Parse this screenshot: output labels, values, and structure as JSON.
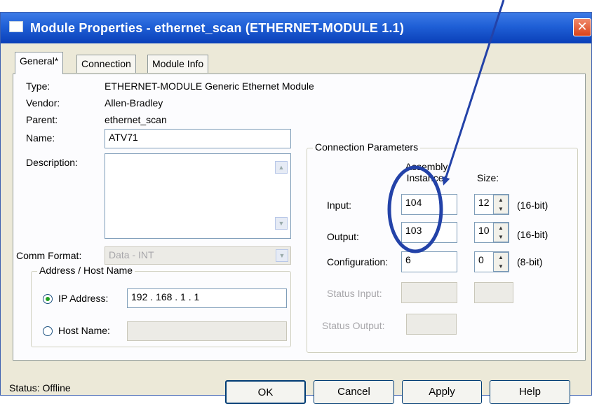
{
  "window": {
    "title": "Module Properties  - ethernet_scan (ETHERNET-MODULE 1.1)",
    "close_glyph": "✕"
  },
  "tabs": [
    {
      "label": "General*",
      "active": true
    },
    {
      "label": "Connection",
      "active": false
    },
    {
      "label": "Module Info",
      "active": false
    }
  ],
  "general": {
    "type_label": "Type:",
    "type_value": "ETHERNET-MODULE Generic Ethernet Module",
    "vendor_label": "Vendor:",
    "vendor_value": "Allen-Bradley",
    "parent_label": "Parent:",
    "parent_value": "ethernet_scan",
    "name_label": "Name:",
    "name_value": "ATV71",
    "description_label": "Description:",
    "description_value": "",
    "comm_format_label": "Comm Format:",
    "comm_format_value": "Data - INT"
  },
  "address_group": {
    "title": "Address / Host Name",
    "ip_label": "IP Address:",
    "ip_value": "192 . 168 .  1  .  1",
    "ip_selected": true,
    "host_label": "Host Name:",
    "host_value": ""
  },
  "connection_params": {
    "title": "Connection Parameters",
    "assembly_header": "Assembly Instance:",
    "size_header": "Size:",
    "rows": [
      {
        "label": "Input:",
        "instance": "104",
        "size": "12",
        "unit": "(16-bit)"
      },
      {
        "label": "Output:",
        "instance": "103",
        "size": "10",
        "unit": "(16-bit)"
      },
      {
        "label": "Configuration:",
        "instance": "6",
        "size": "0",
        "unit": "(8-bit)"
      }
    ],
    "status_input_label": "Status Input:",
    "status_output_label": "Status Output:"
  },
  "footer": {
    "status": "Status:  Offline",
    "ok": "OK",
    "cancel": "Cancel",
    "apply": "Apply",
    "help": "Help"
  },
  "annotation_color": "#2342a8",
  "window_title_color": "#0a3fb8"
}
